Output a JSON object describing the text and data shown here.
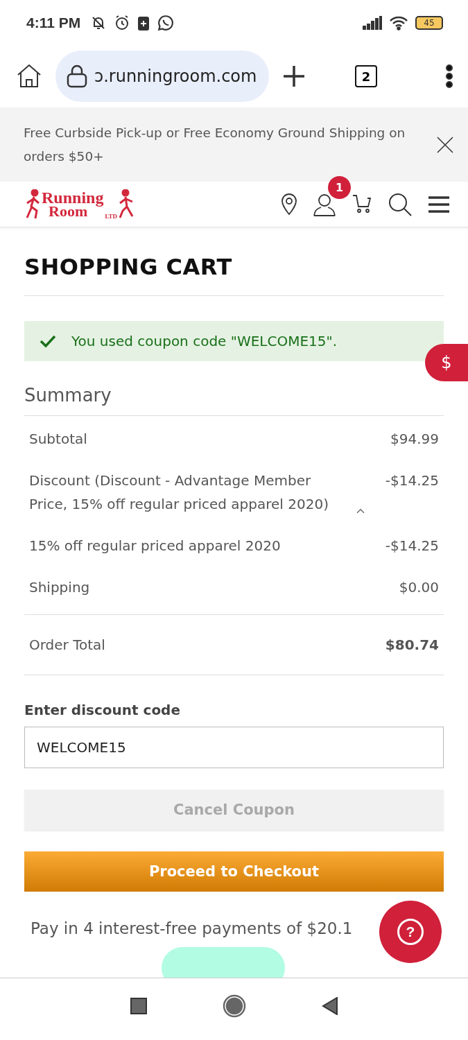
{
  "status_bar": {
    "time": "4:11 PM",
    "battery": "45"
  },
  "browser": {
    "url": "ɔ.runningroom.com",
    "tab_count": "2"
  },
  "banner": {
    "text": "Free Curbside Pick-up or Free Economy Ground Shipping on orders $50+"
  },
  "header": {
    "logo": {
      "word_1": "Running",
      "word_2": "Room",
      "suffix": "LTD"
    },
    "cart_count": "1"
  },
  "page": {
    "title": "SHOPPING CART",
    "notice": "You used coupon code \"WELCOME15\".",
    "side_tab": "$"
  },
  "summary": {
    "title": "Summary",
    "rows": [
      {
        "kind": "line",
        "label": "Subtotal",
        "amount": "$94.99"
      },
      {
        "kind": "expandable",
        "label": "Discount (Discount - Advantage Member Price, 15% off regular priced apparel 2020)",
        "amount": "-$14.25",
        "expanded": true
      },
      {
        "kind": "line",
        "label": "15% off regular priced apparel 2020",
        "amount": "-$14.25"
      },
      {
        "kind": "line",
        "label": "Shipping",
        "amount": "$0.00"
      },
      {
        "kind": "total",
        "label": "Order Total",
        "amount": "$80.74"
      }
    ]
  },
  "discount": {
    "label": "Enter discount code",
    "value": "WELCOME15",
    "cancel_button": {
      "label": "Cancel Coupon",
      "disabled": true
    }
  },
  "checkout_button": "Proceed to Checkout",
  "installments": "Pay in 4 interest-free payments of $20.1",
  "help_button": "?"
}
